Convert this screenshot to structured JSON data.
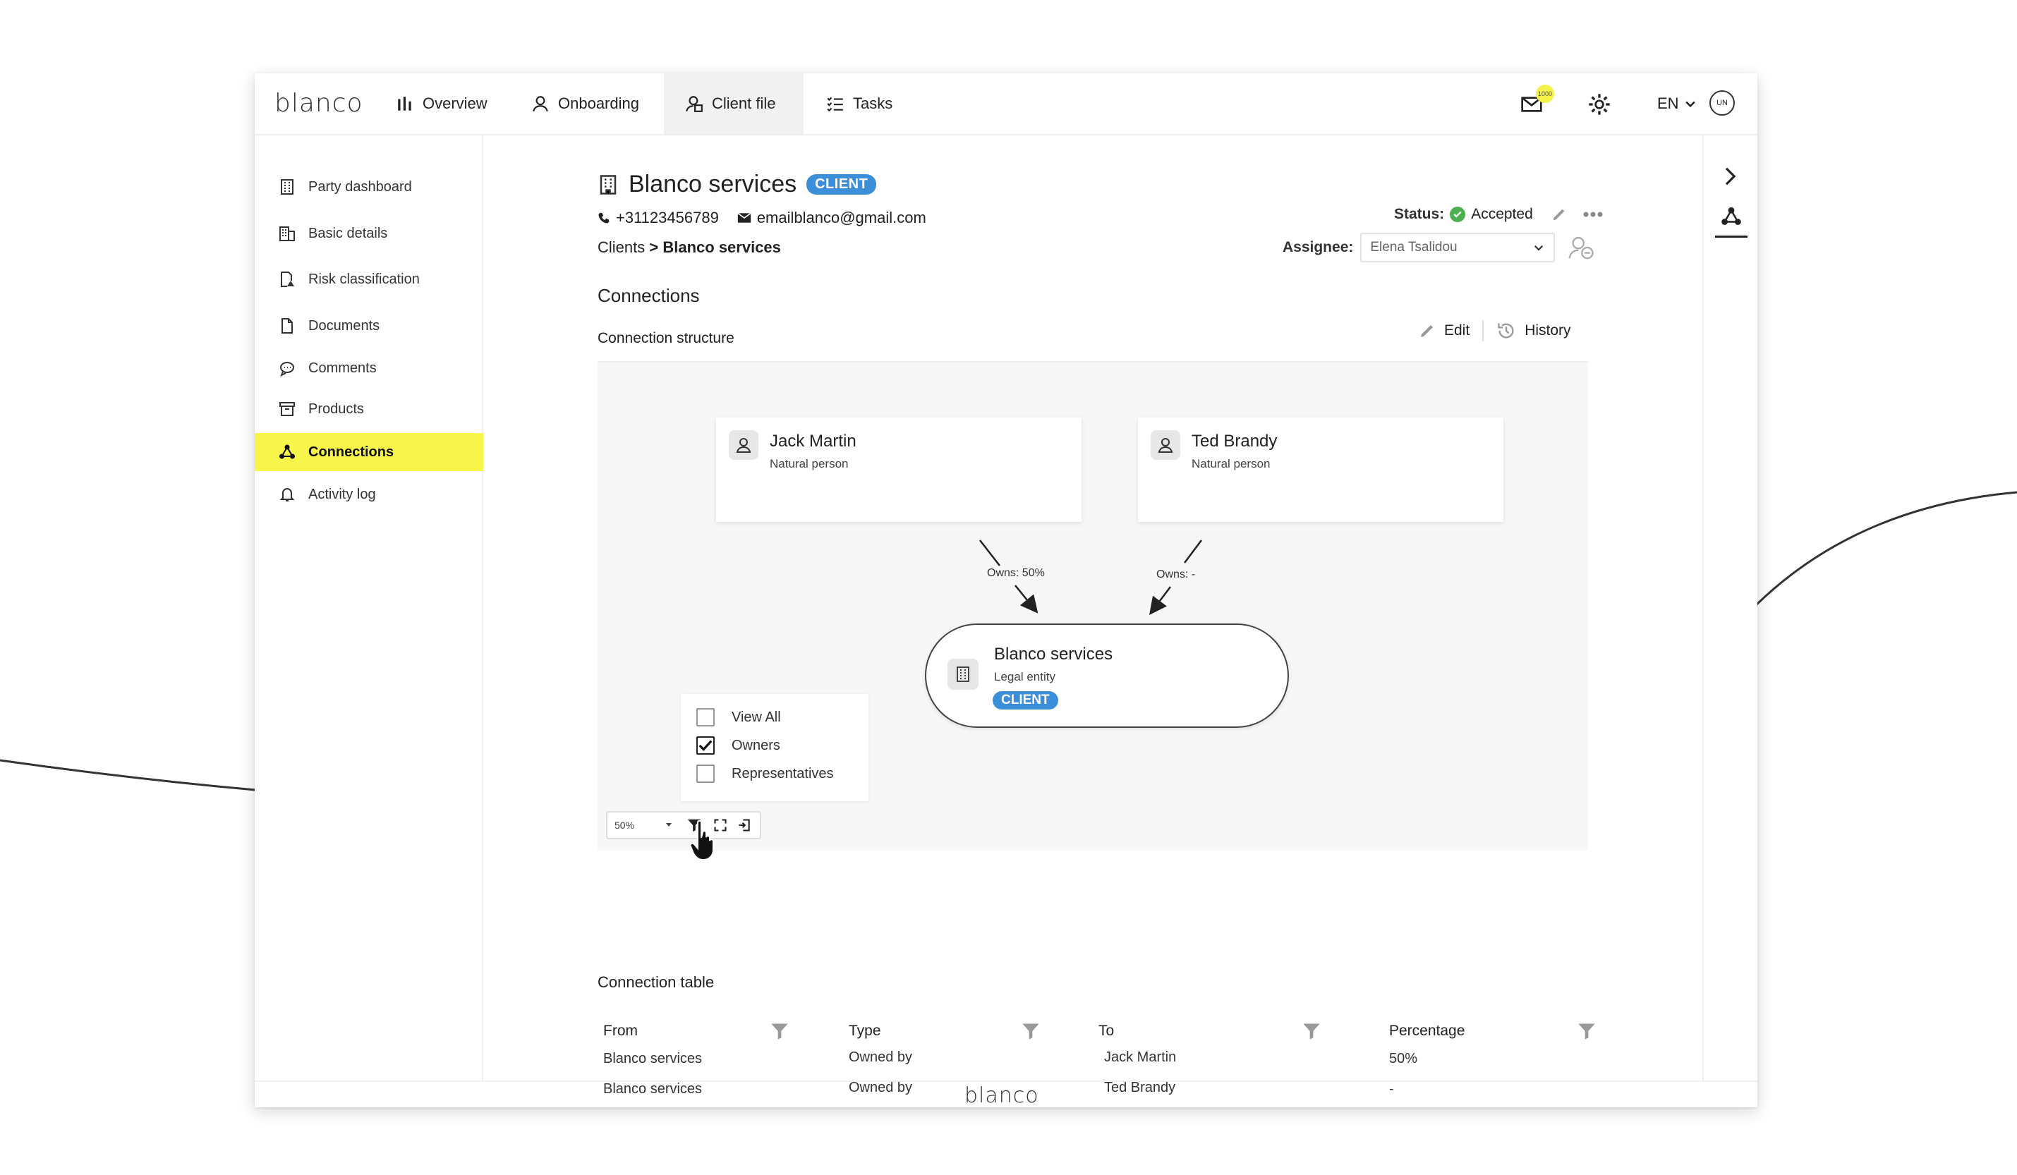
{
  "app": {
    "logo": "blanco",
    "footer_logo": "blanco"
  },
  "nav": {
    "items": [
      {
        "label": "Overview",
        "icon": "bar-chart-icon"
      },
      {
        "label": "Onboarding",
        "icon": "user-icon"
      },
      {
        "label": "Client file",
        "icon": "user-file-icon",
        "active": true
      },
      {
        "label": "Tasks",
        "icon": "task-list-icon"
      }
    ],
    "mail_badge": "1000",
    "language": "EN",
    "avatar_initials": "UN"
  },
  "sidebar": {
    "items": [
      {
        "label": "Party dashboard",
        "icon": "dashboard-icon"
      },
      {
        "label": "Basic details",
        "icon": "building-icon"
      },
      {
        "label": "Risk classification",
        "icon": "risk-icon"
      },
      {
        "label": "Documents",
        "icon": "document-icon"
      },
      {
        "label": "Comments",
        "icon": "comment-icon"
      },
      {
        "label": "Products",
        "icon": "archive-icon"
      },
      {
        "label": "Connections",
        "icon": "connections-icon",
        "active": true
      },
      {
        "label": "Activity log",
        "icon": "bell-icon"
      }
    ]
  },
  "header": {
    "title": "Blanco services",
    "tag": "CLIENT",
    "phone": "+31123456789",
    "email": "emailblanco@gmail.com",
    "breadcrumb_root": "Clients",
    "breadcrumb_sep": ">",
    "breadcrumb_current": "Blanco services",
    "status_label": "Status:",
    "status_value": "Accepted",
    "assignee_label": "Assignee:",
    "assignee_value": "Elena Tsalidou"
  },
  "connections": {
    "section_title": "Connections",
    "structure_title": "Connection structure",
    "edit_label": "Edit",
    "history_label": "History",
    "nodes": [
      {
        "name": "Jack Martin",
        "kind": "Natural person"
      },
      {
        "name": "Ted Brandy",
        "kind": "Natural person"
      }
    ],
    "entity": {
      "name": "Blanco services",
      "kind": "Legal entity",
      "tag": "CLIENT"
    },
    "edges": [
      {
        "label": "Owns: 50%"
      },
      {
        "label": "Owns: -"
      }
    ],
    "filters": [
      {
        "label": "View All",
        "checked": false
      },
      {
        "label": "Owners",
        "checked": true
      },
      {
        "label": "Representatives",
        "checked": false
      }
    ],
    "zoom": "50%"
  },
  "table": {
    "title": "Connection table",
    "columns": [
      "From",
      "Type",
      "To",
      "Percentage"
    ],
    "rows": [
      [
        "Blanco services",
        "Owned by",
        "Jack Martin",
        "50%"
      ],
      [
        "Blanco services",
        "Owned by",
        "Ted Brandy",
        "-"
      ]
    ]
  },
  "colors": {
    "accent_yellow": "#f7f54a",
    "client_blue": "#3a8fd8",
    "status_green": "#4caf50"
  }
}
